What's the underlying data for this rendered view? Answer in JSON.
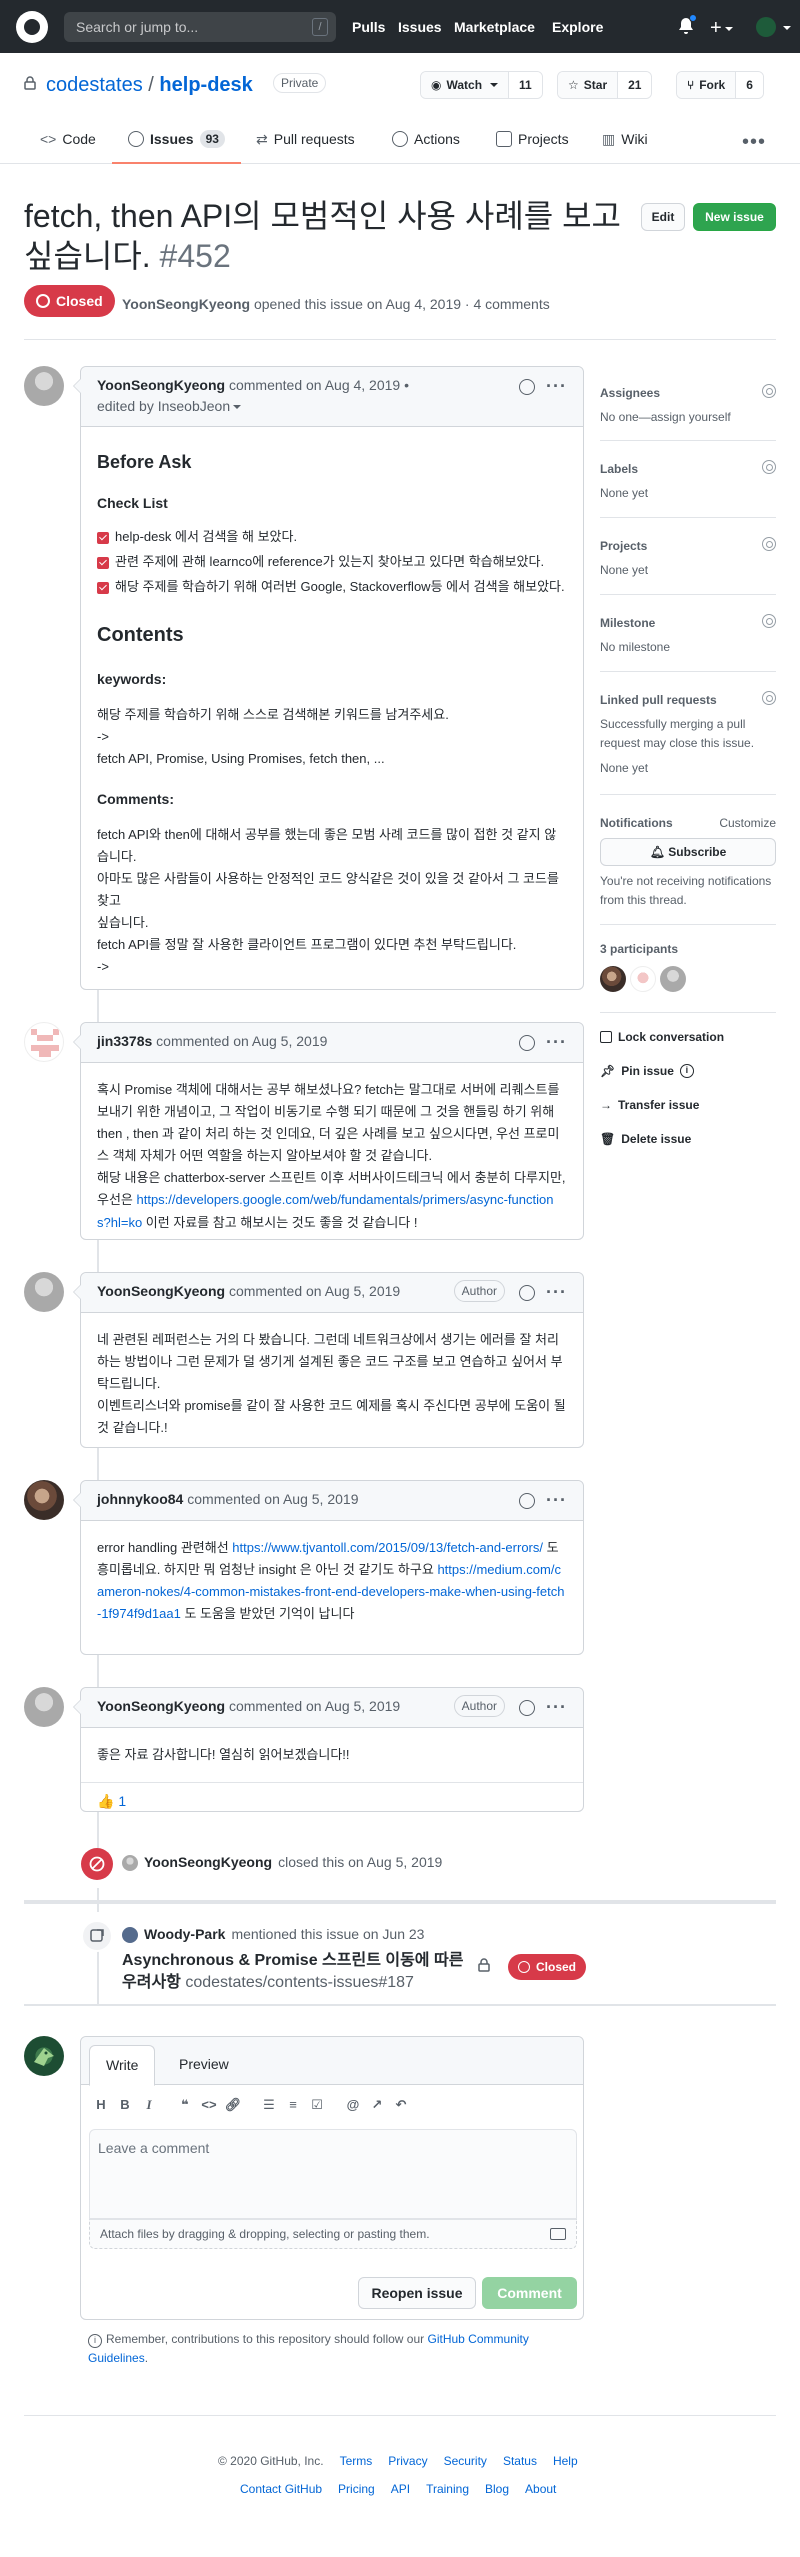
{
  "header": {
    "search_placeholder": "Search or jump to...",
    "slash_key": "/",
    "nav": [
      "Pulls",
      "Issues",
      "Marketplace",
      "Explore"
    ]
  },
  "repo": {
    "owner": "codestates",
    "separator": "/",
    "name": "help-desk",
    "visibility": "Private",
    "watch_label": "Watch",
    "watch_count": "11",
    "star_label": "Star",
    "star_count": "21",
    "fork_label": "Fork",
    "fork_count": "6"
  },
  "tabs": [
    {
      "label": "Code"
    },
    {
      "label": "Issues",
      "count": "93"
    },
    {
      "label": "Pull requests"
    },
    {
      "label": "Actions"
    },
    {
      "label": "Projects"
    },
    {
      "label": "Wiki"
    }
  ],
  "issue": {
    "title": "fetch, then API의 모범적인 사용 사례를 보고 싶습니다.",
    "number": "#452",
    "state": "Closed",
    "edit_label": "Edit",
    "new_issue_label": "New issue",
    "meta_author": "YoonSeongKyeong",
    "meta_text": "opened this issue on Aug 4, 2019 · 4 comments"
  },
  "first_comment": {
    "author": "YoonSeongKyeong",
    "commented": "commented on Aug 4, 2019 •",
    "edited_by": "edited by InseobJeon",
    "h_before_ask": "Before Ask",
    "h_checklist": "Check List",
    "checks": [
      "help-desk 에서 검색을 해 보았다.",
      "관련 주제에 관해 learnco에 reference가 있는지 찾아보고 있다면 학습해보았다.",
      "해당 주제를 학습하기 위해 여러번 Google, Stackoverflow등 에서 검색을 해보았다."
    ],
    "h_contents": "Contents",
    "h_keywords": "keywords:",
    "keywords_line1": "해당 주제를 학습하기 위해 스스로 검색해본 키워드를 남겨주세요.",
    "keywords_line2": "->",
    "keywords_line3": "fetch API, Promise, Using Promises, fetch then, ...",
    "h_comments": "Comments:",
    "comments_text": "fetch API와 then에 대해서 공부를 했는데 좋은 모범 사례 코드를 많이 접한 것 같지 않습니다.\n아마도 많은 사람들이 사용하는 안정적인 코드 양식같은 것이 있을 것 같아서 그 코드를 찾고\n싶습니다.\nfetch API를 정말 잘 사용한 클라이언트 프로그램이 있다면 추천 부탁드립니다.\n->"
  },
  "comments": [
    {
      "author": "jin3378s",
      "meta": "commented on Aug 5, 2019",
      "body_pre": "혹시 Promise 객체에 대해서는 공부 해보셨나요? fetch는 말그대로 서버에 리퀘스트를 보내기 위한 개념이고, 그 작업이 비동기로 수행 되기 때문에 그 것을 핸들링 하기 위해 then , then 과 같이 처리 하는 것 인데요, 더 깊은 사례를 보고 싶으시다면, 우선 프로미스 객체 자체가 어떤 역할을 하는지 알아보셔야 할 것 같습니다.\n해당 내용은 chatterbox-server 스프린트 이후 서버사이드테크닉 에서 충분히 다루지만, 우선은 ",
      "link": "https://developers.google.com/web/fundamentals/primers/async-functions?hl=ko",
      "body_post": " 이런 자료를 참고 해보시는 것도 좋을 것 같습니다 !"
    },
    {
      "author": "YoonSeongKyeong",
      "meta": "commented on Aug 5, 2019",
      "badge": "Author",
      "body": "네 관련된 레퍼런스는 거의 다 봤습니다. 그런데 네트워크상에서 생기는 에러를 잘 처리하는 방법이나 그런 문제가 덜 생기게 설계된 좋은 코드 구조를 보고 연습하고 싶어서 부탁드립니다.\n이벤트리스너와 promise를 같이 잘 사용한 코드 예제를 혹시 주신다면 공부에 도움이 될 것 같습니다.!"
    },
    {
      "author": "johnnykoo84",
      "meta": "commented on Aug 5, 2019",
      "body_pre": "error handling 관련해선 ",
      "link1": "https://www.tjvantoll.com/2015/09/13/fetch-and-errors/",
      "body_mid": " 도 흥미롭네요. 하지만 뭐 엄청난 insight 은 아닌 것 같기도 하구요 ",
      "link2": "https://medium.com/cameron-nokes/4-common-mistakes-front-end-developers-make-when-using-fetch-1f974f9d1aa1",
      "body_post": " 도 도움을 받았던 기억이 납니다"
    },
    {
      "author": "YoonSeongKyeong",
      "meta": "commented on Aug 5, 2019",
      "badge": "Author",
      "body": "좋은 자료 감사합니다! 열심히 읽어보겠습니다!!",
      "reaction_emoji": "👍",
      "reaction_count": "1"
    }
  ],
  "events": {
    "closed_actor": "YoonSeongKyeong",
    "closed_text": "closed this on Aug 5, 2019",
    "mention_actor": "Woody-Park",
    "mention_text": "mentioned this issue on Jun 23",
    "ref_title": "Asynchronous & Promise 스프린트 이동에 따른 우려사항",
    "ref_repo": "codestates/contents-issues#187",
    "ref_state": "Closed"
  },
  "sidebar": {
    "assignees_h": "Assignees",
    "assignees_v": "No one—assign yourself",
    "labels_h": "Labels",
    "labels_v": "None yet",
    "projects_h": "Projects",
    "projects_v": "None yet",
    "milestone_h": "Milestone",
    "milestone_v": "No milestone",
    "linked_h": "Linked pull requests",
    "linked_desc": "Successfully merging a pull request may close this issue.",
    "linked_v": "None yet",
    "notif_h": "Notifications",
    "notif_customize": "Customize",
    "subscribe_label": "Subscribe",
    "notif_desc": "You're not receiving notifications from this thread.",
    "participants_h": "3 participants",
    "lock": "Lock conversation",
    "pin": "Pin issue",
    "transfer": "Transfer issue",
    "delete": "Delete issue"
  },
  "form": {
    "tab_write": "Write",
    "tab_preview": "Preview",
    "placeholder": "Leave a comment",
    "attach": "Attach files by dragging & dropping, selecting or pasting them.",
    "reopen": "Reopen issue",
    "comment": "Comment",
    "remember_pre": "Remember, contributions to this repository should follow our ",
    "remember_link": "GitHub Community Guidelines",
    "remember_post": "."
  },
  "footer": {
    "copyright": "© 2020 GitHub, Inc.",
    "row1": [
      "Terms",
      "Privacy",
      "Security",
      "Status",
      "Help"
    ],
    "row2": [
      "Contact GitHub",
      "Pricing",
      "API",
      "Training",
      "Blog",
      "About"
    ]
  },
  "colors": {
    "header_bg": "#24292e",
    "closed_red": "#d73a49",
    "primary_green": "#2ea44f",
    "link_blue": "#0366d6"
  }
}
